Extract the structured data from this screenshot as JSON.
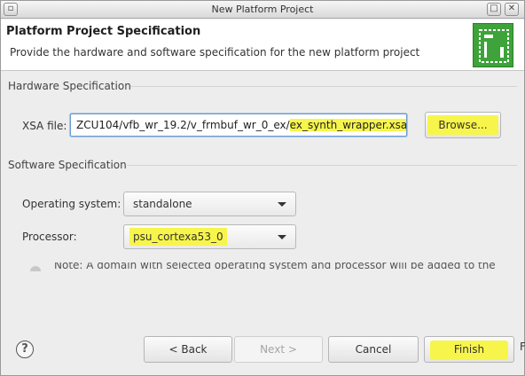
{
  "window": {
    "title": "New Platform Project",
    "menu_glyph": "▫",
    "max_glyph": "□",
    "close_glyph": "✕"
  },
  "header": {
    "title": "Platform Project Specification",
    "description": "Provide the hardware and software specification for the new platform project",
    "logo_icon": "vitis-platform-icon"
  },
  "hardware": {
    "section_label": "Hardware Specification",
    "xsa_label": "XSA file:",
    "xsa_value_prefix": "ZCU104/vfb_wr_19.2/v_frmbuf_wr_0_ex/",
    "xsa_value_highlight": "ex_synth_wrapper.xsa",
    "browse_label": "Browse..."
  },
  "software": {
    "section_label": "Software Specification",
    "os_label": "Operating system:",
    "os_value": "standalone",
    "processor_label": "Processor:",
    "processor_value": "psu_cortexa53_0",
    "note": "Note: A domain with selected operating system and processor will be added to the"
  },
  "footer": {
    "help_glyph": "?",
    "back_label": "< Back",
    "next_label": "Next >",
    "cancel_label": "Cancel",
    "finish_label": "Finish",
    "edge_glyph": "F"
  },
  "colors": {
    "highlight": "#f7f54b",
    "logo_green": "#3ea33a",
    "input_focus": "#6a9bd1"
  }
}
